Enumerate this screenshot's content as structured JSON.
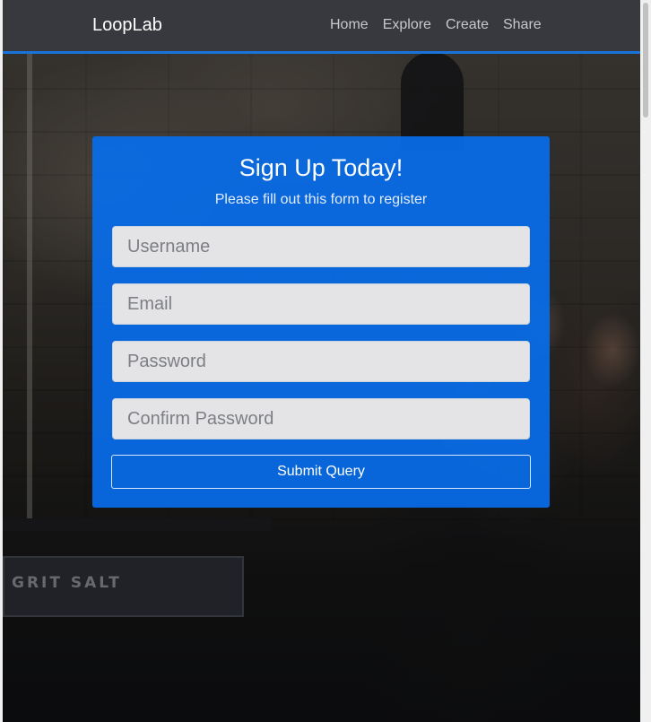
{
  "navbar": {
    "brand": "LoopLab",
    "links": [
      "Home",
      "Explore",
      "Create",
      "Share"
    ]
  },
  "background": {
    "sign_text": "GRIT SALT"
  },
  "signup": {
    "title": "Sign Up Today!",
    "subtitle": "Please fill out this form to register",
    "fields": {
      "username": {
        "placeholder": "Username",
        "value": ""
      },
      "email": {
        "placeholder": "Email",
        "value": ""
      },
      "password": {
        "placeholder": "Password",
        "value": ""
      },
      "confirm_password": {
        "placeholder": "Confirm Password",
        "value": ""
      }
    },
    "submit_label": "Submit Query"
  },
  "colors": {
    "accent": "#1a73d9",
    "card": "#086eeb",
    "navbar": "#373a40"
  }
}
